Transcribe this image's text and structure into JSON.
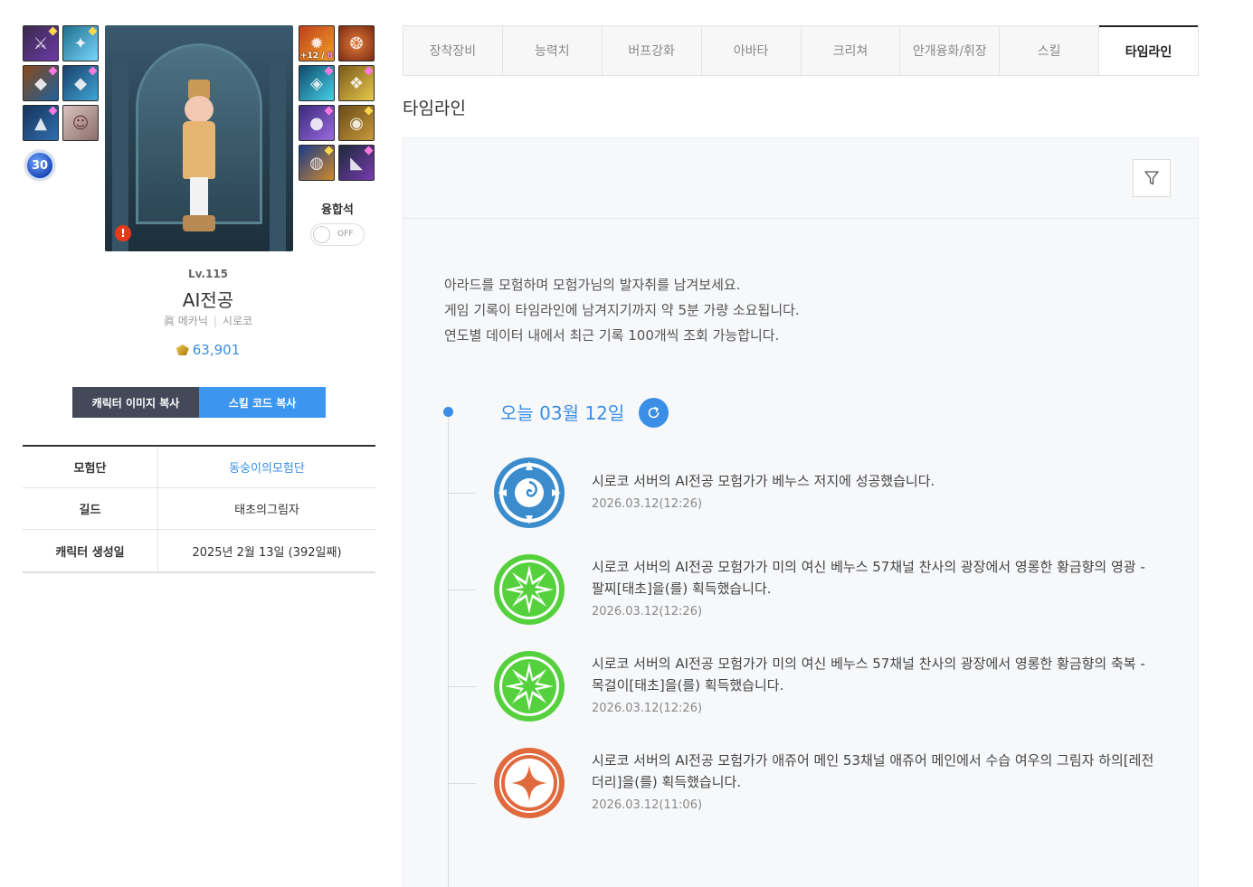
{
  "colors": {
    "accent": "#3a8ee6",
    "dark_button": "#44495a",
    "alert": "#e8391c",
    "green_event": "#55d13d",
    "blue_event": "#3a8ccd",
    "orange_event": "#e06a3e"
  },
  "character": {
    "level": "Lv.115",
    "name": "AI전공",
    "job": "眞 메카닉",
    "server": "시로코",
    "power": "63,901",
    "badge_level": "30",
    "fusion_label": "융합석",
    "fusion_toggle": "OFF",
    "equip_enhance": "+12",
    "equip_enhance2": "8",
    "alert_mark": "!"
  },
  "buttons": {
    "copy_image": "캐릭터 이미지 복사",
    "copy_skill": "스킬 코드 복사"
  },
  "info": [
    {
      "key": "모험단",
      "value": "동숭이의모험단",
      "link": true
    },
    {
      "key": "길드",
      "value": "태초의그림자",
      "link": false
    },
    {
      "key": "캐릭터 생성일",
      "value": "2025년 2월 13일 (392일째)",
      "link": false
    }
  ],
  "tabs": [
    "장착장비",
    "능력치",
    "버프강화",
    "아바타",
    "크리쳐",
    "안개융화/휘장",
    "스킬",
    "타임라인"
  ],
  "active_tab": "타임라인",
  "section_title": "타임라인",
  "description": [
    "아라드를 모험하며 모험가님의 발자취를 남겨보세요.",
    "게임 기록이 타임라인에 남겨지기까지 약 5분 가량 소요됩니다.",
    "연도별 데이터 내에서 최근 기록 100개씩 조회 가능합니다."
  ],
  "timeline": {
    "today_label": "오늘 03월 12일",
    "entries": [
      {
        "icon": "raid-clear-icon",
        "text": "시로코 서버의 AI전공 모험가가 베누스 저지에 성공했습니다.",
        "date": "2026.03.12(12:26)"
      },
      {
        "icon": "epic-drop-icon",
        "text": "시로코 서버의 AI전공 모험가가 미의 여신 베누스 57채널 찬사의 광장에서 영롱한 황금향의 영광 - 팔찌[태초]을(를) 획득했습니다.",
        "date": "2026.03.12(12:26)"
      },
      {
        "icon": "epic-drop-icon",
        "text": "시로코 서버의 AI전공 모험가가 미의 여신 베누스 57채널 찬사의 광장에서 영롱한 황금향의 축복 - 목걸이[태초]을(를) 획득했습니다.",
        "date": "2026.03.12(12:26)"
      },
      {
        "icon": "legendary-drop-icon",
        "text": "시로코 서버의 AI전공 모험가가 애쥬어 메인 53채널 애쥬어 메인에서 수습 여우의 그림자 하의[레전더리]을(를) 획득했습니다.",
        "date": "2026.03.12(11:06)"
      }
    ]
  }
}
